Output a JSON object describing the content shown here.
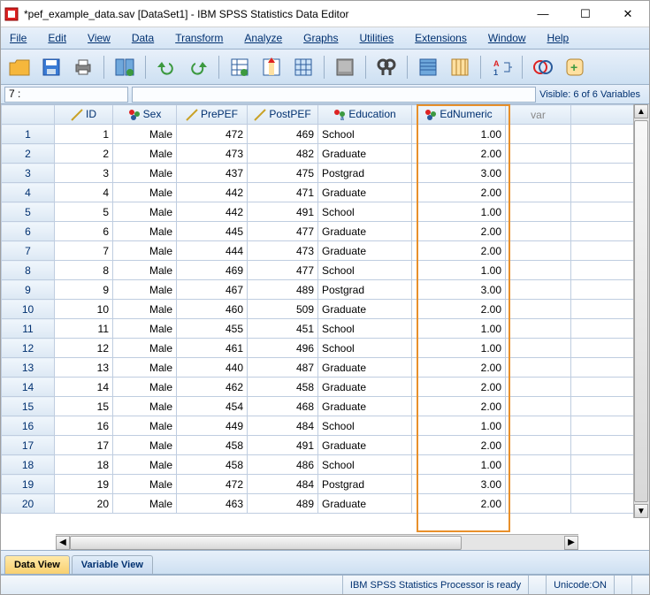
{
  "window_title": "*pef_example_data.sav [DataSet1] - IBM SPSS Statistics Data Editor",
  "menu": [
    "File",
    "Edit",
    "View",
    "Data",
    "Transform",
    "Analyze",
    "Graphs",
    "Utilities",
    "Extensions",
    "Window",
    "Help"
  ],
  "cellref": "7 :",
  "visible_text": "Visible: 6 of 6 Variables",
  "columns": {
    "ID": "ID",
    "Sex": "Sex",
    "PrePEF": "PrePEF",
    "PostPEF": "PostPEF",
    "Education": "Education",
    "EdNumeric": "EdNumeric",
    "var": "var"
  },
  "rows": [
    {
      "n": "1",
      "ID": "1",
      "Sex": "Male",
      "PrePEF": "472",
      "PostPEF": "469",
      "Education": "School",
      "EdNumeric": "1.00"
    },
    {
      "n": "2",
      "ID": "2",
      "Sex": "Male",
      "PrePEF": "473",
      "PostPEF": "482",
      "Education": "Graduate",
      "EdNumeric": "2.00"
    },
    {
      "n": "3",
      "ID": "3",
      "Sex": "Male",
      "PrePEF": "437",
      "PostPEF": "475",
      "Education": "Postgrad",
      "EdNumeric": "3.00"
    },
    {
      "n": "4",
      "ID": "4",
      "Sex": "Male",
      "PrePEF": "442",
      "PostPEF": "471",
      "Education": "Graduate",
      "EdNumeric": "2.00"
    },
    {
      "n": "5",
      "ID": "5",
      "Sex": "Male",
      "PrePEF": "442",
      "PostPEF": "491",
      "Education": "School",
      "EdNumeric": "1.00"
    },
    {
      "n": "6",
      "ID": "6",
      "Sex": "Male",
      "PrePEF": "445",
      "PostPEF": "477",
      "Education": "Graduate",
      "EdNumeric": "2.00"
    },
    {
      "n": "7",
      "ID": "7",
      "Sex": "Male",
      "PrePEF": "444",
      "PostPEF": "473",
      "Education": "Graduate",
      "EdNumeric": "2.00"
    },
    {
      "n": "8",
      "ID": "8",
      "Sex": "Male",
      "PrePEF": "469",
      "PostPEF": "477",
      "Education": "School",
      "EdNumeric": "1.00"
    },
    {
      "n": "9",
      "ID": "9",
      "Sex": "Male",
      "PrePEF": "467",
      "PostPEF": "489",
      "Education": "Postgrad",
      "EdNumeric": "3.00"
    },
    {
      "n": "10",
      "ID": "10",
      "Sex": "Male",
      "PrePEF": "460",
      "PostPEF": "509",
      "Education": "Graduate",
      "EdNumeric": "2.00"
    },
    {
      "n": "11",
      "ID": "11",
      "Sex": "Male",
      "PrePEF": "455",
      "PostPEF": "451",
      "Education": "School",
      "EdNumeric": "1.00"
    },
    {
      "n": "12",
      "ID": "12",
      "Sex": "Male",
      "PrePEF": "461",
      "PostPEF": "496",
      "Education": "School",
      "EdNumeric": "1.00"
    },
    {
      "n": "13",
      "ID": "13",
      "Sex": "Male",
      "PrePEF": "440",
      "PostPEF": "487",
      "Education": "Graduate",
      "EdNumeric": "2.00"
    },
    {
      "n": "14",
      "ID": "14",
      "Sex": "Male",
      "PrePEF": "462",
      "PostPEF": "458",
      "Education": "Graduate",
      "EdNumeric": "2.00"
    },
    {
      "n": "15",
      "ID": "15",
      "Sex": "Male",
      "PrePEF": "454",
      "PostPEF": "468",
      "Education": "Graduate",
      "EdNumeric": "2.00"
    },
    {
      "n": "16",
      "ID": "16",
      "Sex": "Male",
      "PrePEF": "449",
      "PostPEF": "484",
      "Education": "School",
      "EdNumeric": "1.00"
    },
    {
      "n": "17",
      "ID": "17",
      "Sex": "Male",
      "PrePEF": "458",
      "PostPEF": "491",
      "Education": "Graduate",
      "EdNumeric": "2.00"
    },
    {
      "n": "18",
      "ID": "18",
      "Sex": "Male",
      "PrePEF": "458",
      "PostPEF": "486",
      "Education": "School",
      "EdNumeric": "1.00"
    },
    {
      "n": "19",
      "ID": "19",
      "Sex": "Male",
      "PrePEF": "472",
      "PostPEF": "484",
      "Education": "Postgrad",
      "EdNumeric": "3.00"
    },
    {
      "n": "20",
      "ID": "20",
      "Sex": "Male",
      "PrePEF": "463",
      "PostPEF": "489",
      "Education": "Graduate",
      "EdNumeric": "2.00"
    }
  ],
  "tabs": {
    "data_view": "Data View",
    "variable_view": "Variable View"
  },
  "status": {
    "processor": "IBM SPSS Statistics Processor is ready",
    "unicode": "Unicode:ON"
  }
}
